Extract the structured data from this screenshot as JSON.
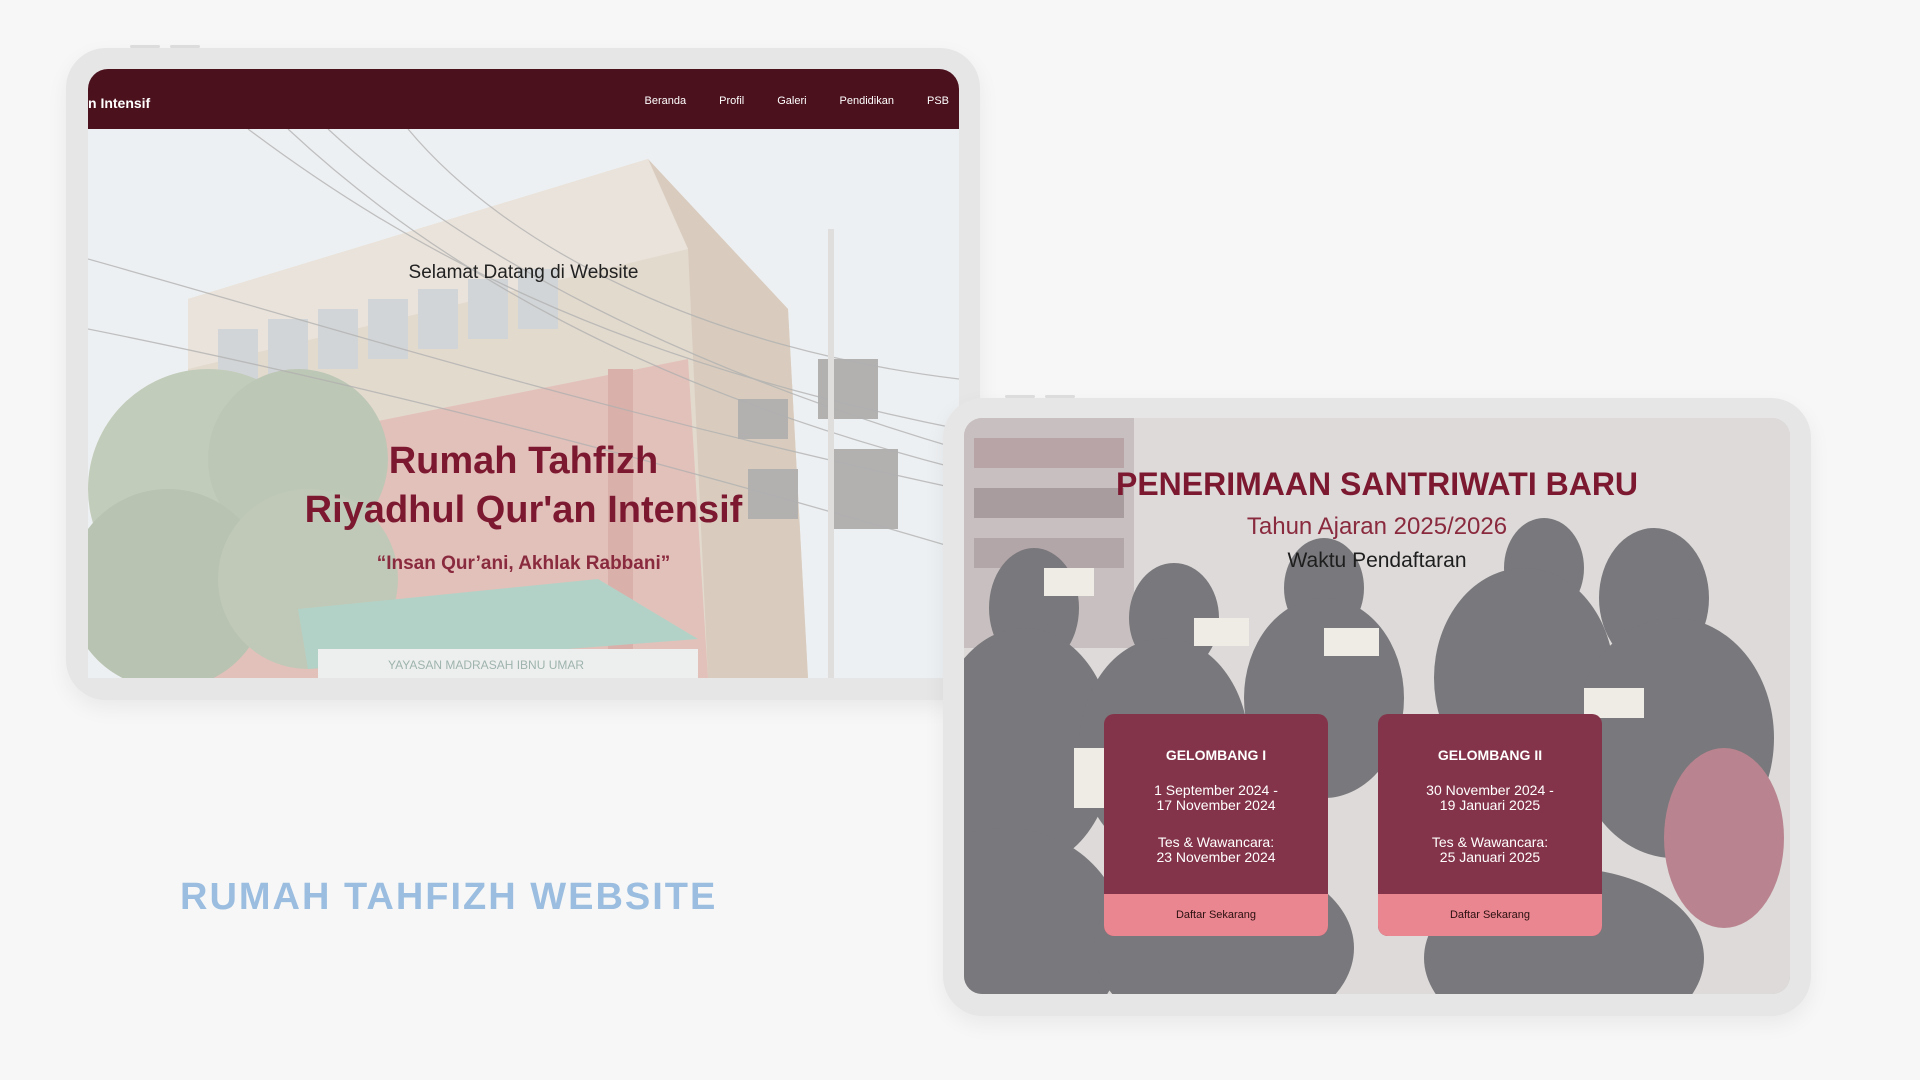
{
  "caption": "RUMAH TAHFIZH WEBSITE",
  "colors": {
    "navbar": "#4b111d",
    "title_maroon": "#7c1830",
    "card": "#84344a",
    "card_button": "#e98690",
    "caption": "#9bbddf"
  },
  "home_screen": {
    "brand": "n Intensif",
    "nav": [
      "Beranda",
      "Profil",
      "Galeri",
      "Pendidikan",
      "PSB"
    ],
    "welcome": "Selamat Datang di Website",
    "title_line1": "Rumah Tahfizh",
    "title_line2": "Riyadhul Qur'an Intensif",
    "tagline": "“Insan Qur’ani, Akhlak Rabbani”",
    "sign_text": "YAYASAN MADRASAH IBNU UMAR"
  },
  "psb_screen": {
    "title": "PENERIMAAN SANTRIWATI BARU",
    "year": "Tahun Ajaran 2025/2026",
    "period_label": "Waktu Pendaftaran",
    "waves": [
      {
        "name": "GELOMBANG I",
        "dates_line1": "1 September 2024 -",
        "dates_line2": "17 November 2024",
        "test_line1": "Tes & Wawancara:",
        "test_line2": "23 November 2024",
        "button": "Daftar Sekarang"
      },
      {
        "name": "GELOMBANG II",
        "dates_line1": "30 November 2024 -",
        "dates_line2": "19 Januari 2025",
        "test_line1": "Tes & Wawancara:",
        "test_line2": "25 Januari 2025",
        "button": "Daftar Sekarang"
      }
    ]
  }
}
